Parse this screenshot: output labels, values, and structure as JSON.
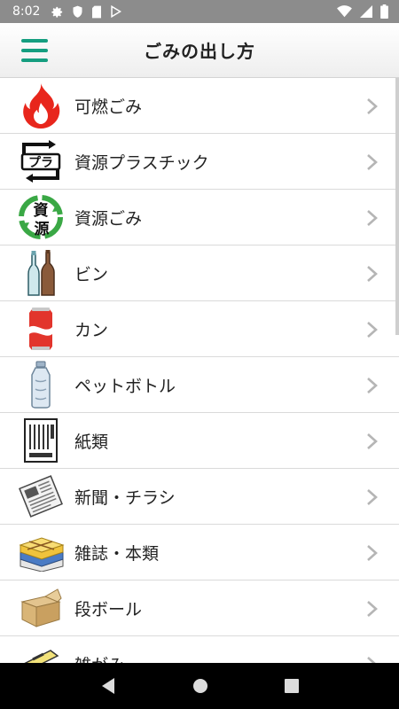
{
  "status_bar": {
    "time": "8:02"
  },
  "app_bar": {
    "title": "ごみの出し方"
  },
  "icon_text": {
    "pla": "プラ",
    "shigen_1": "資",
    "shigen_2": "源"
  },
  "items": [
    {
      "label": "可燃ごみ",
      "icon": "fire-icon"
    },
    {
      "label": "資源プラスチック",
      "icon": "plastic-recycle-icon"
    },
    {
      "label": "資源ごみ",
      "icon": "resource-recycle-icon"
    },
    {
      "label": "ビン",
      "icon": "bottle-icon"
    },
    {
      "label": "カン",
      "icon": "can-icon"
    },
    {
      "label": "ペットボトル",
      "icon": "pet-bottle-icon"
    },
    {
      "label": "紙類",
      "icon": "paper-icon"
    },
    {
      "label": "新聞・チラシ",
      "icon": "newspaper-icon"
    },
    {
      "label": "雑誌・本類",
      "icon": "magazine-icon"
    },
    {
      "label": "段ボール",
      "icon": "cardboard-icon"
    },
    {
      "label": "雑がみ",
      "icon": "misc-paper-icon"
    }
  ],
  "colors": {
    "accent": "#159e80",
    "status_bar": "#8c8c8c",
    "chevron": "#b5b5b5"
  }
}
